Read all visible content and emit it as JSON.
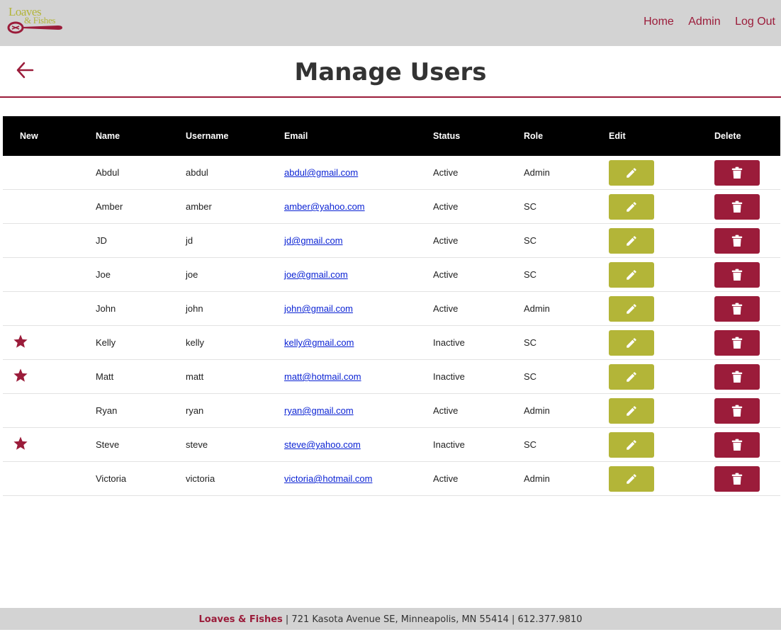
{
  "brand": {
    "logo_line1": "Loaves",
    "logo_line2": "& Fishes"
  },
  "nav": {
    "home": "Home",
    "admin": "Admin",
    "logout": "Log Out"
  },
  "page": {
    "title": "Manage Users"
  },
  "table": {
    "headers": {
      "new": "New",
      "name": "Name",
      "username": "Username",
      "email": "Email",
      "status": "Status",
      "role": "Role",
      "edit": "Edit",
      "delete": "Delete"
    },
    "rows": [
      {
        "new": false,
        "name": "Abdul",
        "username": "abdul",
        "email": "abdul@gmail.com",
        "status": "Active",
        "role": "Admin"
      },
      {
        "new": false,
        "name": "Amber",
        "username": "amber",
        "email": "amber@yahoo.com",
        "status": "Active",
        "role": "SC"
      },
      {
        "new": false,
        "name": "JD",
        "username": "jd",
        "email": "jd@gmail.com",
        "status": "Active",
        "role": "SC"
      },
      {
        "new": false,
        "name": "Joe",
        "username": "joe",
        "email": "joe@gmail.com",
        "status": "Active",
        "role": "SC"
      },
      {
        "new": false,
        "name": "John",
        "username": "john",
        "email": "john@gmail.com",
        "status": "Active",
        "role": "Admin"
      },
      {
        "new": true,
        "name": "Kelly",
        "username": "kelly",
        "email": "kelly@gmail.com",
        "status": "Inactive",
        "role": "SC"
      },
      {
        "new": true,
        "name": "Matt",
        "username": "matt",
        "email": "matt@hotmail.com",
        "status": "Inactive",
        "role": "SC"
      },
      {
        "new": false,
        "name": "Ryan",
        "username": "ryan",
        "email": "ryan@gmail.com",
        "status": "Active",
        "role": "Admin"
      },
      {
        "new": true,
        "name": "Steve",
        "username": "steve",
        "email": "steve@yahoo.com",
        "status": "Inactive",
        "role": "SC"
      },
      {
        "new": false,
        "name": "Victoria",
        "username": "victoria",
        "email": "victoria@hotmail.com",
        "status": "Active",
        "role": "Admin"
      }
    ]
  },
  "footer": {
    "brand": "Loaves & Fishes",
    "address": " | 721 Kasota Avenue SE, Minneapolis, MN 55414 | 612.377.9810"
  },
  "colors": {
    "accent": "#9b1c3a",
    "olive": "#b3b538",
    "nav_bg": "#d3d3d3",
    "header_bg": "#000000",
    "link": "#0b23d4"
  },
  "icons": {
    "back": "arrow-left-icon",
    "new": "star-icon",
    "edit": "pencil-icon",
    "delete": "trash-icon",
    "logo": "spoon-icon"
  }
}
